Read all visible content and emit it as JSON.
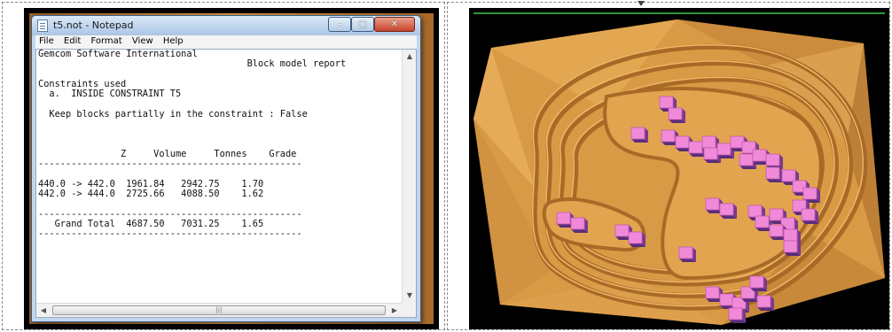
{
  "notepad": {
    "title": "t5.not - Notepad",
    "window_buttons": {
      "minimize": "–",
      "maximize": "□",
      "close": "✕"
    },
    "menu": [
      "File",
      "Edit",
      "Format",
      "View",
      "Help"
    ],
    "report": {
      "company": "Gemcom Software International",
      "report_title": "Block model report",
      "constraints_heading": "Constraints used",
      "constraint_item": "a.  INSIDE CONSTRAINT T5",
      "partial_blocks": "Keep blocks partially in the constraint : False",
      "columns": [
        "Z",
        "Volume",
        "Tonnes",
        "Grade"
      ],
      "rows": [
        {
          "z": "440.0 -> 442.0",
          "volume": "1961.84",
          "tonnes": "2942.75",
          "grade": "1.70"
        },
        {
          "z": "442.0 -> 444.0",
          "volume": "2725.66",
          "tonnes": "4088.50",
          "grade": "1.62"
        }
      ],
      "total": {
        "label": "Grand Total",
        "volume": "4687.50",
        "tonnes": "7031.25",
        "grade": "1.65"
      }
    },
    "scrollbar": {
      "up": "▲",
      "down": "▼",
      "left": "◀",
      "right": "▶",
      "thumb_grip": "|||"
    }
  },
  "pit_view": {
    "colors": {
      "terrain": "#d99a45",
      "bench": "#a86a26",
      "block_top": "#f08ad8",
      "block_side": "#5a2d7a",
      "frame": "#000000",
      "accent_line": "#2f9a3a"
    }
  }
}
